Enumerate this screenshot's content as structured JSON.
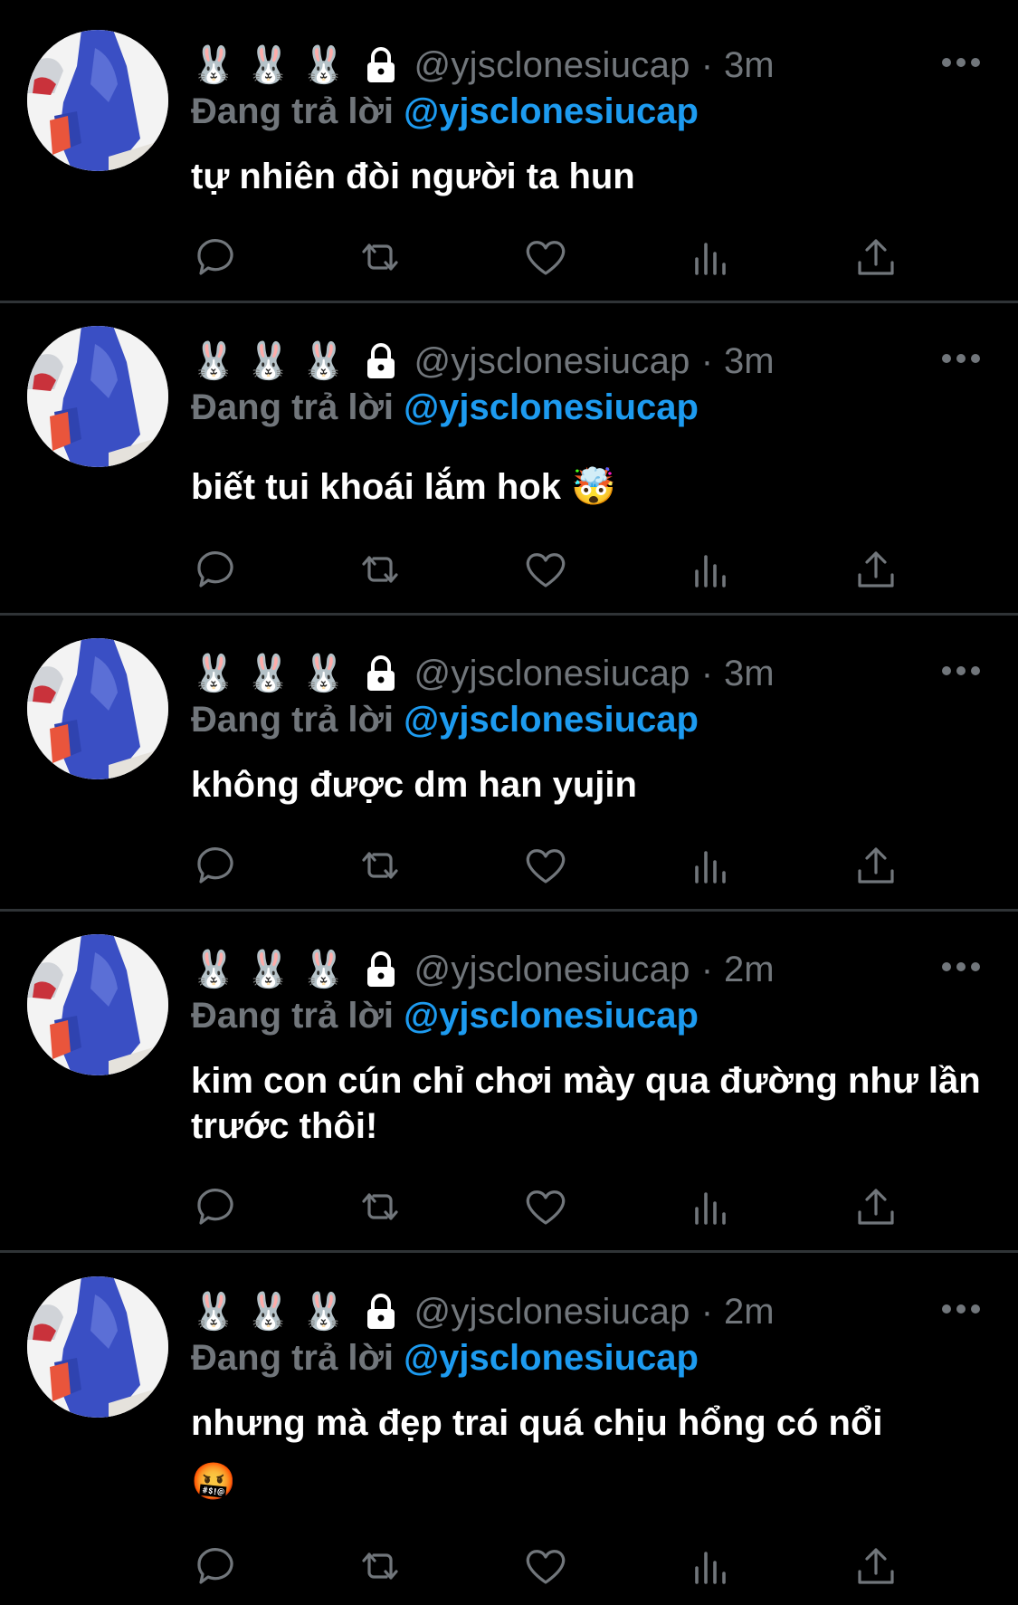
{
  "colors": {
    "background": "#000000",
    "divider": "#2f3336",
    "muted": "#71767b",
    "mention": "#1d9bf0",
    "text": "#ffffff"
  },
  "tweets": [
    {
      "name_emoji": [
        "🐰",
        "🐰",
        "🐰"
      ],
      "handle": "@yjsclonesiucap",
      "separator": "·",
      "time": "3m",
      "reply_prefix": "Đang trả lời",
      "reply_handle": "@yjsclonesiucap",
      "text": "tự nhiên đòi người ta hun",
      "emoji": ""
    },
    {
      "name_emoji": [
        "🐰",
        "🐰",
        "🐰"
      ],
      "handle": "@yjsclonesiucap",
      "separator": "·",
      "time": "3m",
      "reply_prefix": "Đang trả lời",
      "reply_handle": "@yjsclonesiucap",
      "text": "biết tui khoái lắm hok",
      "emoji": "🤯"
    },
    {
      "name_emoji": [
        "🐰",
        "🐰",
        "🐰"
      ],
      "handle": "@yjsclonesiucap",
      "separator": "·",
      "time": "3m",
      "reply_prefix": "Đang trả lời",
      "reply_handle": "@yjsclonesiucap",
      "text": "không được dm han yujin",
      "emoji": ""
    },
    {
      "name_emoji": [
        "🐰",
        "🐰",
        "🐰"
      ],
      "handle": "@yjsclonesiucap",
      "separator": "·",
      "time": "2m",
      "reply_prefix": "Đang trả lời",
      "reply_handle": "@yjsclonesiucap",
      "text": "kim con cún chỉ chơi mày qua đường như lần trước thôi!",
      "emoji": ""
    },
    {
      "name_emoji": [
        "🐰",
        "🐰",
        "🐰"
      ],
      "handle": "@yjsclonesiucap",
      "separator": "·",
      "time": "2m",
      "reply_prefix": "Đang trả lời",
      "reply_handle": "@yjsclonesiucap",
      "text": "nhưng mà đẹp trai quá chịu hổng có nổi",
      "emoji": "🤬"
    }
  ],
  "action_icons": [
    "reply-icon",
    "retweet-icon",
    "like-icon",
    "views-icon",
    "share-icon"
  ]
}
